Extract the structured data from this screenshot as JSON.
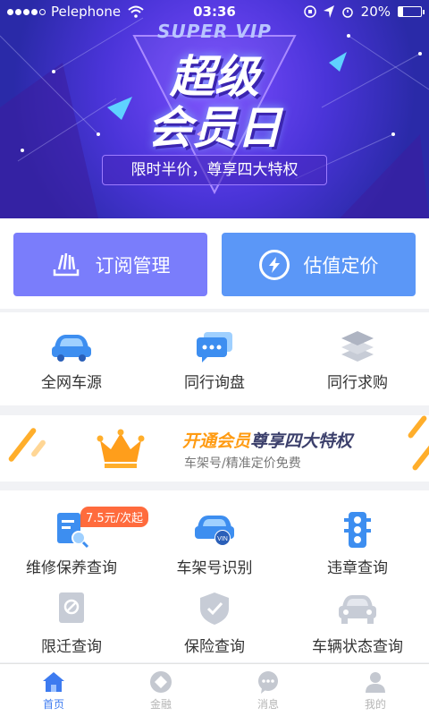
{
  "status_bar": {
    "carrier": "Pelephone",
    "time": "03:36",
    "battery": "20%",
    "battery_level": 0.2
  },
  "banner": {
    "super_vip": "SUPER VIP",
    "headline_1": "超级",
    "headline_2": "会员日",
    "tagline": "限时半价，尊享四大特权"
  },
  "actions": {
    "subscribe": "订阅管理",
    "valuation": "估值定价"
  },
  "quick_row": [
    {
      "label": "全网车源",
      "icon": "car-icon"
    },
    {
      "label": "同行询盘",
      "icon": "chat-bubbles-icon"
    },
    {
      "label": "同行求购",
      "icon": "stacked-layers-icon"
    }
  ],
  "promo": {
    "title_highlight": "开通会员",
    "title_rest": "尊享四大特权",
    "subtitle": "车架号/精准定价免费",
    "icon": "crown-icon",
    "accent": "#ffae2b"
  },
  "services": [
    {
      "label": "维修保养查询",
      "icon": "document-search-icon",
      "badge": "7.5元/次起"
    },
    {
      "label": "车架号识别",
      "icon": "vin-car-icon"
    },
    {
      "label": "违章查询",
      "icon": "traffic-light-icon"
    },
    {
      "label": "限迁查询",
      "icon": "restricted-doc-icon"
    },
    {
      "label": "保险查询",
      "icon": "shield-check-icon"
    },
    {
      "label": "车辆状态查询",
      "icon": "car-front-icon"
    }
  ],
  "tabbar": [
    {
      "label": "首页",
      "icon": "home-icon",
      "active": true
    },
    {
      "label": "金融",
      "icon": "finance-icon",
      "active": false
    },
    {
      "label": "消息",
      "icon": "message-icon",
      "active": false
    },
    {
      "label": "我的",
      "icon": "profile-icon",
      "active": false
    }
  ],
  "colors": {
    "primary": "#3d7bf0",
    "subscribe_bg": "#7a7dfb",
    "valuation_bg": "#5b97f7",
    "badge": "#ff6b3d",
    "promo_orange": "#ff9b12"
  }
}
